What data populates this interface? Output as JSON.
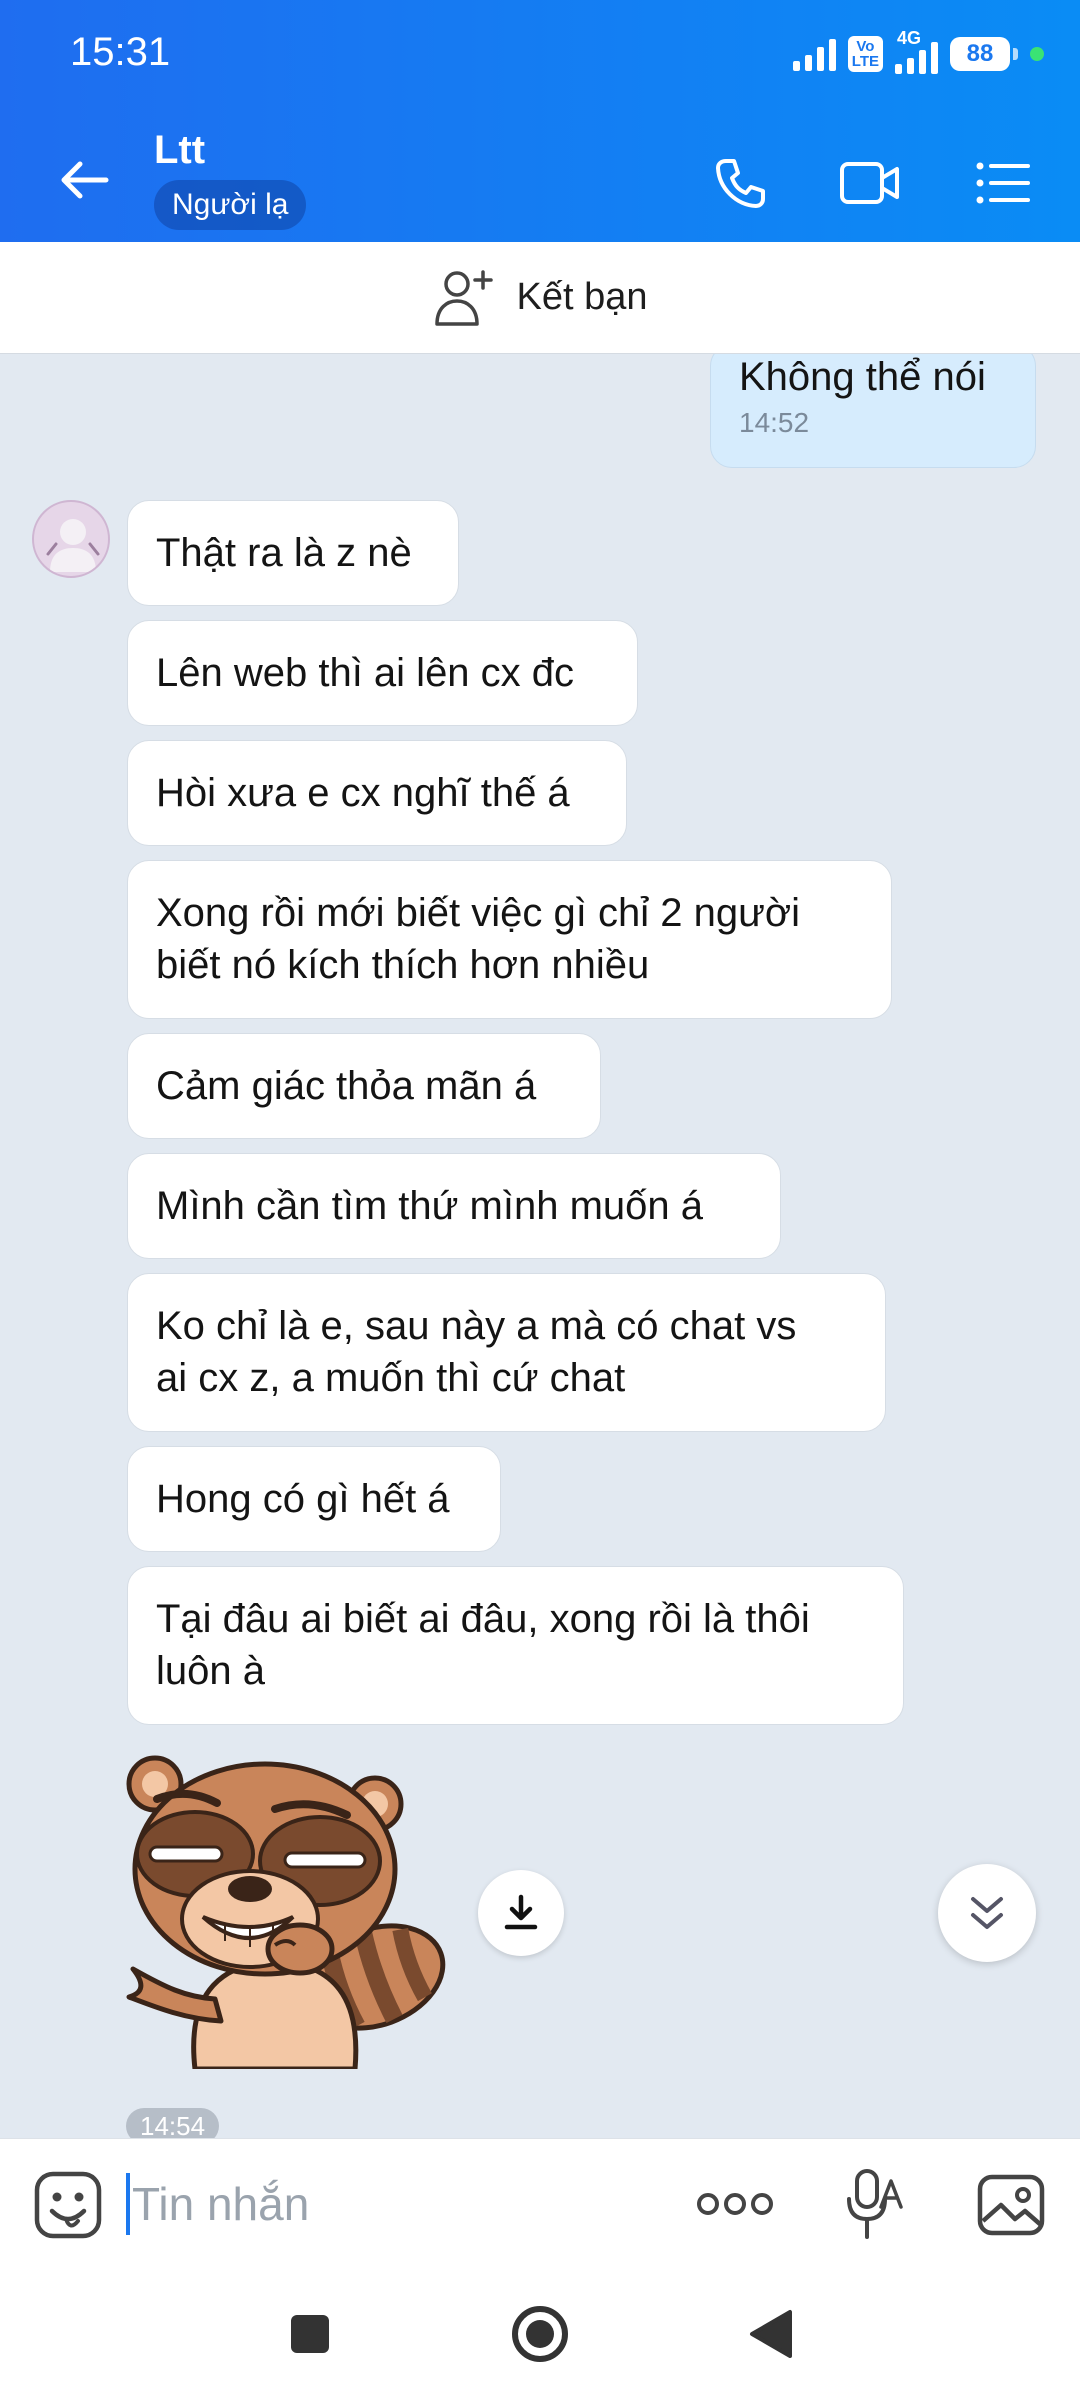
{
  "status_bar": {
    "time": "15:31",
    "volte": "Vo\nLTE",
    "network": "4G",
    "battery": "88"
  },
  "header": {
    "contact_name": "Ltt",
    "badge": "Người lạ"
  },
  "friend_bar": {
    "label": "Kết bạn"
  },
  "messages": {
    "sent": {
      "text": "Không thể nói",
      "time": "14:52"
    },
    "received": [
      "Thật ra là z nè",
      "Lên web thì ai lên cx đc",
      "Hòi xưa e cx nghĩ thế á",
      "Xong rồi mới biết việc gì chỉ 2 người\nbiết nó kích thích hơn nhiều",
      "Cảm giác thỏa mãn á",
      "Mình cần tìm thứ mình muốn á",
      "Ko chỉ là e, sau này a mà có chat vs\nai cx z, a muốn thì cứ chat",
      "Hong có gì hết á",
      "Tại đâu ai biết ai đâu, xong rồi là thôi\nluôn à"
    ],
    "sticker_time": "14:54"
  },
  "input": {
    "placeholder": "Tin nhắn"
  },
  "icons": {
    "back": "arrow-left-icon",
    "call": "phone-icon",
    "video": "video-camera-icon",
    "menu": "list-menu-icon",
    "add_friend": "add-person-icon",
    "emoji": "emoji-icon",
    "more": "more-dots-icon",
    "mic": "voice-to-text-icon",
    "image": "image-icon",
    "download": "download-icon",
    "scroll": "double-chevron-down-icon"
  },
  "colors": {
    "header_start": "#1f6df0",
    "header_end": "#0a8cf5",
    "sent_bubble": "#d6ecfd",
    "chat_bg": "#e2e9f1",
    "accent": "#1b78ef"
  }
}
